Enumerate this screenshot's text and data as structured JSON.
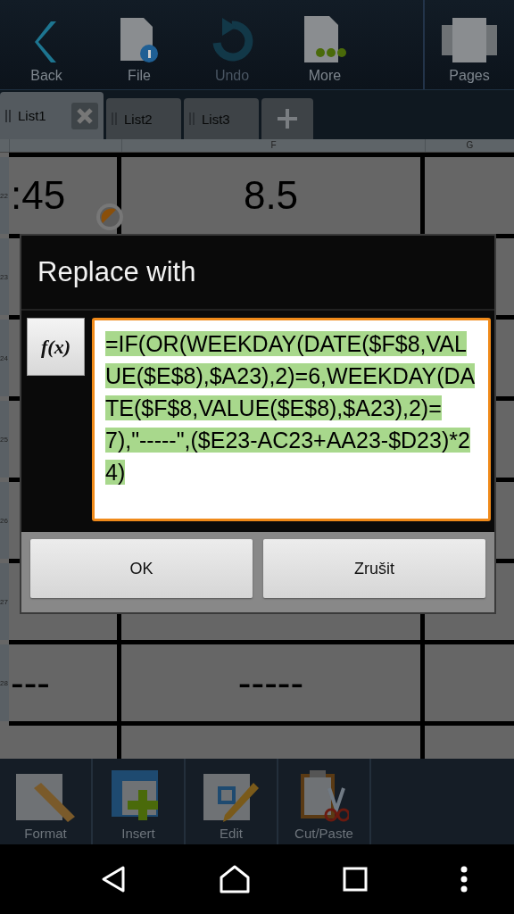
{
  "toolbar": {
    "items": [
      {
        "label": "Back",
        "disabled": false
      },
      {
        "label": "File",
        "disabled": false
      },
      {
        "label": "Undo",
        "disabled": true
      },
      {
        "label": "More",
        "disabled": false
      }
    ],
    "pages": {
      "label": "Pages"
    }
  },
  "tabs": [
    {
      "label": "List1",
      "selected": true
    },
    {
      "label": "List2",
      "selected": false
    },
    {
      "label": "List3",
      "selected": false
    }
  ],
  "sheet": {
    "columns": [
      "",
      "F",
      "G"
    ],
    "rows": [
      {
        "number": "22",
        "cells": [
          ":45",
          "8.5"
        ]
      },
      {
        "number": "23",
        "cells": [
          "",
          ""
        ]
      },
      {
        "number": "24",
        "cells": [
          "",
          ""
        ]
      },
      {
        "number": "25",
        "cells": [
          "",
          ""
        ]
      },
      {
        "number": "26",
        "cells": [
          "",
          ""
        ]
      },
      {
        "number": "27",
        "cells": [
          "",
          ""
        ]
      },
      {
        "number": "28",
        "cells": [
          "---",
          "-----"
        ]
      }
    ]
  },
  "dialog": {
    "title": "Replace with",
    "function_button": "f(x)",
    "field": {
      "value": "=IF(OR(WEEKDAY(DATE($F$8,VALUE($E$8),$A23),2)=6,WEEKDAY(DATE($F$8,VALUE($E$8),$A23),2)=7),\"-----\",($E23-AC23+AA23-$D23)*24)",
      "selected": true
    },
    "buttons": [
      "OK",
      "Zrušit"
    ]
  },
  "bottom_toolbar": [
    {
      "label": "Format"
    },
    {
      "label": "Insert"
    },
    {
      "label": "Edit"
    },
    {
      "label": "Cut/Paste"
    }
  ]
}
